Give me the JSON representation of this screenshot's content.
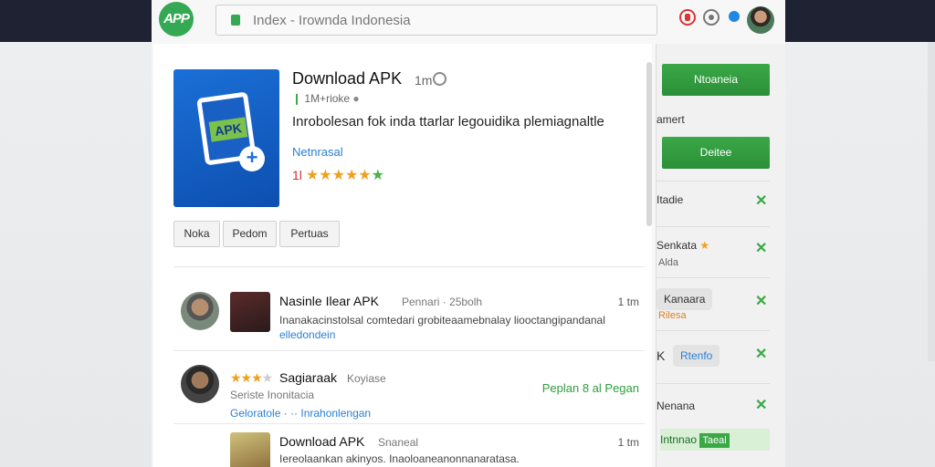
{
  "header": {
    "logo_text": "APP",
    "search_value": "Index - Irownda Indonesia"
  },
  "app": {
    "title": "Download APK",
    "meta_small": "1m",
    "meta_line": "1M+rioke",
    "description": "Inrobolesan fok inda ttarlar legouidika plemiagnaltle",
    "link": "Netnrasal",
    "rating_number": "1l",
    "stars_full": 5,
    "stars_total": 6
  },
  "tabs": [
    {
      "label": "Noka"
    },
    {
      "label": "Pedom"
    },
    {
      "label": "Pertuas"
    }
  ],
  "reviews": [
    {
      "title": "Nasinle Ilear APK",
      "meta": "Pennari · 25bolh",
      "time": "1 tm",
      "body": "Inanakacinstolsal comtedari grobiteaamebnalay liooctangipandanal",
      "link": "elledondein"
    },
    {
      "title": "Sagiaraak",
      "meta": "Koyiase",
      "sub": "Seriste Inonitacia",
      "link": "Geloratole · ·· Inrahonlengan",
      "green_text": "Peplan 8 al Pegan",
      "stars_full": 3,
      "stars_total": 4
    },
    {
      "title": "Download APK",
      "meta": "Snaneal",
      "time": "1 tm",
      "body": "Iereolaankan akinyos. Inaoloaneanonnanaratasa."
    }
  ],
  "sidebar": {
    "btn1": "Ntoaneia",
    "label1": "amert",
    "btn2": "Deitee",
    "items": [
      {
        "label": "Itadie"
      },
      {
        "label": "Senkata",
        "sub": "Alda"
      },
      {
        "label": "Kanaara",
        "sub": "Rilesa"
      },
      {
        "label": "K",
        "pill": "Rtenfo"
      },
      {
        "label": "Nenana"
      }
    ],
    "badge_text": "Intnnao",
    "badge_inner": "Taeal"
  },
  "colors": {
    "accent_green": "#3aa847",
    "link_blue": "#2a7fd4",
    "topbar": "#1e2233"
  }
}
